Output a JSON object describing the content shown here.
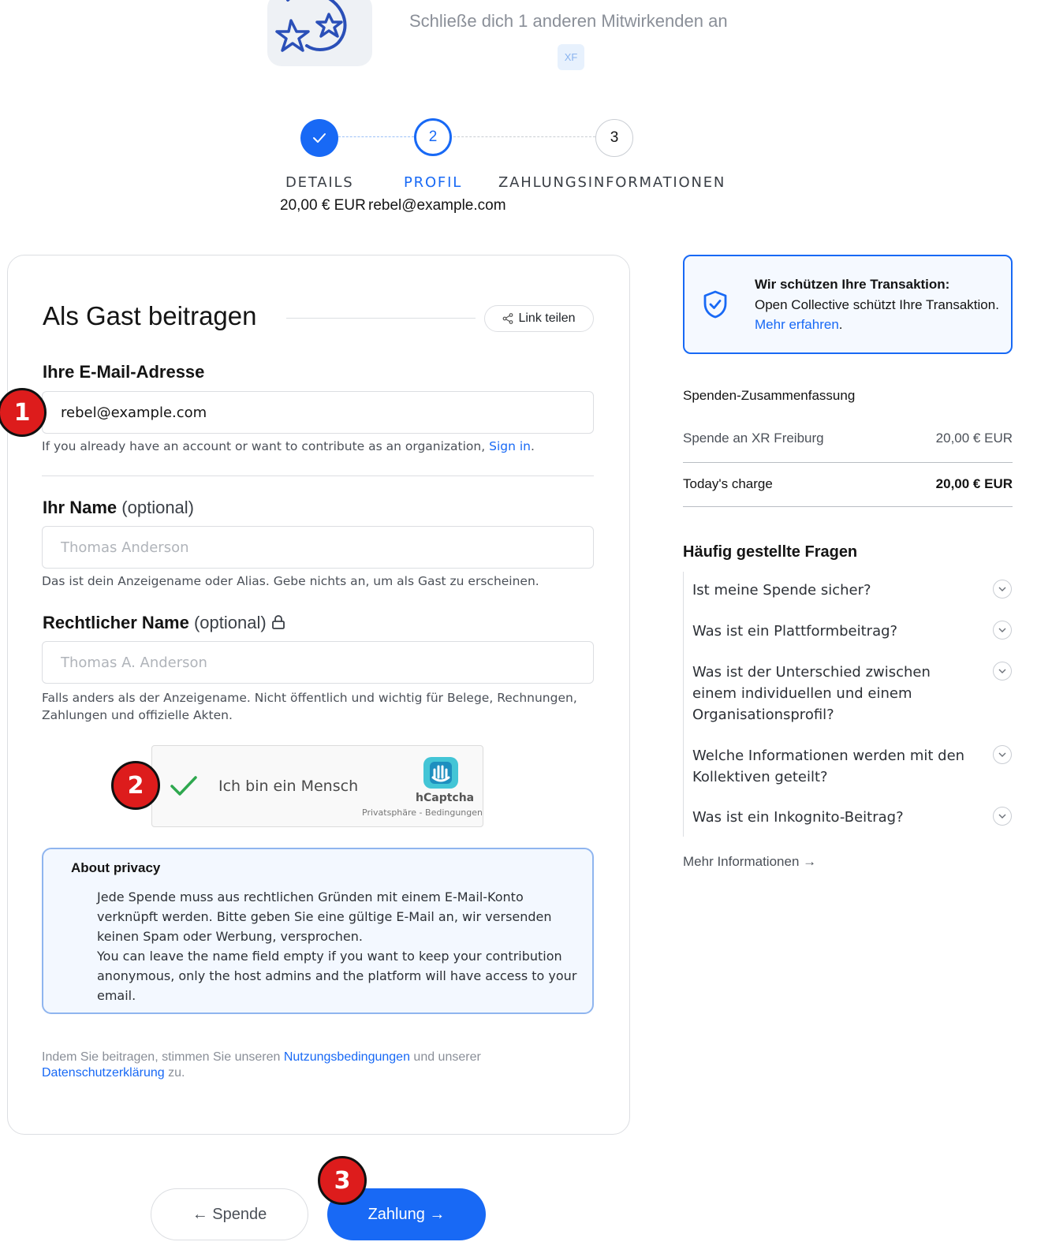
{
  "header": {
    "join_text": "Schließe dich 1 anderen Mitwirkenden an",
    "contributor_badge": "XF"
  },
  "stepper": {
    "steps": [
      {
        "label": "DETAILS",
        "sub": "20,00 € EUR",
        "state": "done"
      },
      {
        "label": "PROFIL",
        "number": "2",
        "sub": "rebel@example.com",
        "state": "active"
      },
      {
        "label": "ZAHLUNGSINFORMATIONEN",
        "number": "3",
        "sub": "",
        "state": "todo"
      }
    ]
  },
  "form": {
    "title": "Als Gast beitragen",
    "share_label": "Link teilen",
    "email": {
      "label": "Ihre E-Mail-Adresse",
      "value": "rebel@example.com",
      "help_prefix": "If you already have an account or want to contribute as an organization, ",
      "help_link": "Sign in",
      "help_suffix": "."
    },
    "name": {
      "label": "Ihr Name",
      "optional": "(optional)",
      "placeholder": "Thomas Anderson",
      "help": "Das ist dein Anzeigename oder Alias. Gebe nichts an, um als Gast zu erscheinen."
    },
    "legal_name": {
      "label": "Rechtlicher Name",
      "optional": "(optional)",
      "placeholder": "Thomas A. Anderson",
      "help": "Falls anders als der Anzeigename. Nicht öffentlich und wichtig für Belege, Rechnungen, Zahlungen und offizielle Akten."
    },
    "captcha": {
      "label": "Ich bin ein Mensch",
      "brand": "hCaptcha",
      "links": "Privatsphäre - Bedingungen"
    },
    "privacy": {
      "title": "About privacy",
      "line1": "Jede Spende muss aus rechtlichen Gründen mit einem E-Mail-Konto verknüpft werden. Bitte geben Sie eine gültige E-Mail an, wir versenden keinen Spam oder Werbung, versprochen.",
      "line2": "You can leave the name field empty if you want to keep your contribution anonymous, only the host admins and the platform will have access to your email."
    },
    "terms": {
      "prefix": "Indem Sie beitragen, stimmen Sie unseren ",
      "tos_link": "Nutzungsbedingungen",
      "middle": " und unserer ",
      "privacy_link": "Datenschutzerklärung",
      "suffix": " zu."
    }
  },
  "markers": [
    "1",
    "2",
    "3"
  ],
  "nav": {
    "back_label": "← Spende",
    "next_label": "Zahlung →"
  },
  "sidebar": {
    "secure": {
      "title": "Wir schützen Ihre Transaktion:",
      "text": "Open Collective schützt Ihre Transaktion.",
      "link": "Mehr erfahren",
      "link_suffix": "."
    },
    "summary": {
      "title": "Spenden-Zusammenfassung",
      "item_label": "Spende an XR Freiburg",
      "item_value": "20,00 € EUR",
      "total_label": "Today's charge",
      "total_value": "20,00 € EUR"
    },
    "faq": {
      "title": "Häufig gestellte Fragen",
      "items": [
        "Ist meine Spende sicher?",
        "Was ist ein Plattformbeitrag?",
        "Was ist der Unterschied zwischen einem individuellen und einem Organisationsprofil?",
        "Welche Informationen werden mit den Kollektiven geteilt?",
        "Was ist ein Inkognito-Beitrag?"
      ],
      "more_label": "Mehr Informationen →"
    }
  },
  "colors": {
    "primary": "#1869f5",
    "marker": "#dd1c1c"
  }
}
